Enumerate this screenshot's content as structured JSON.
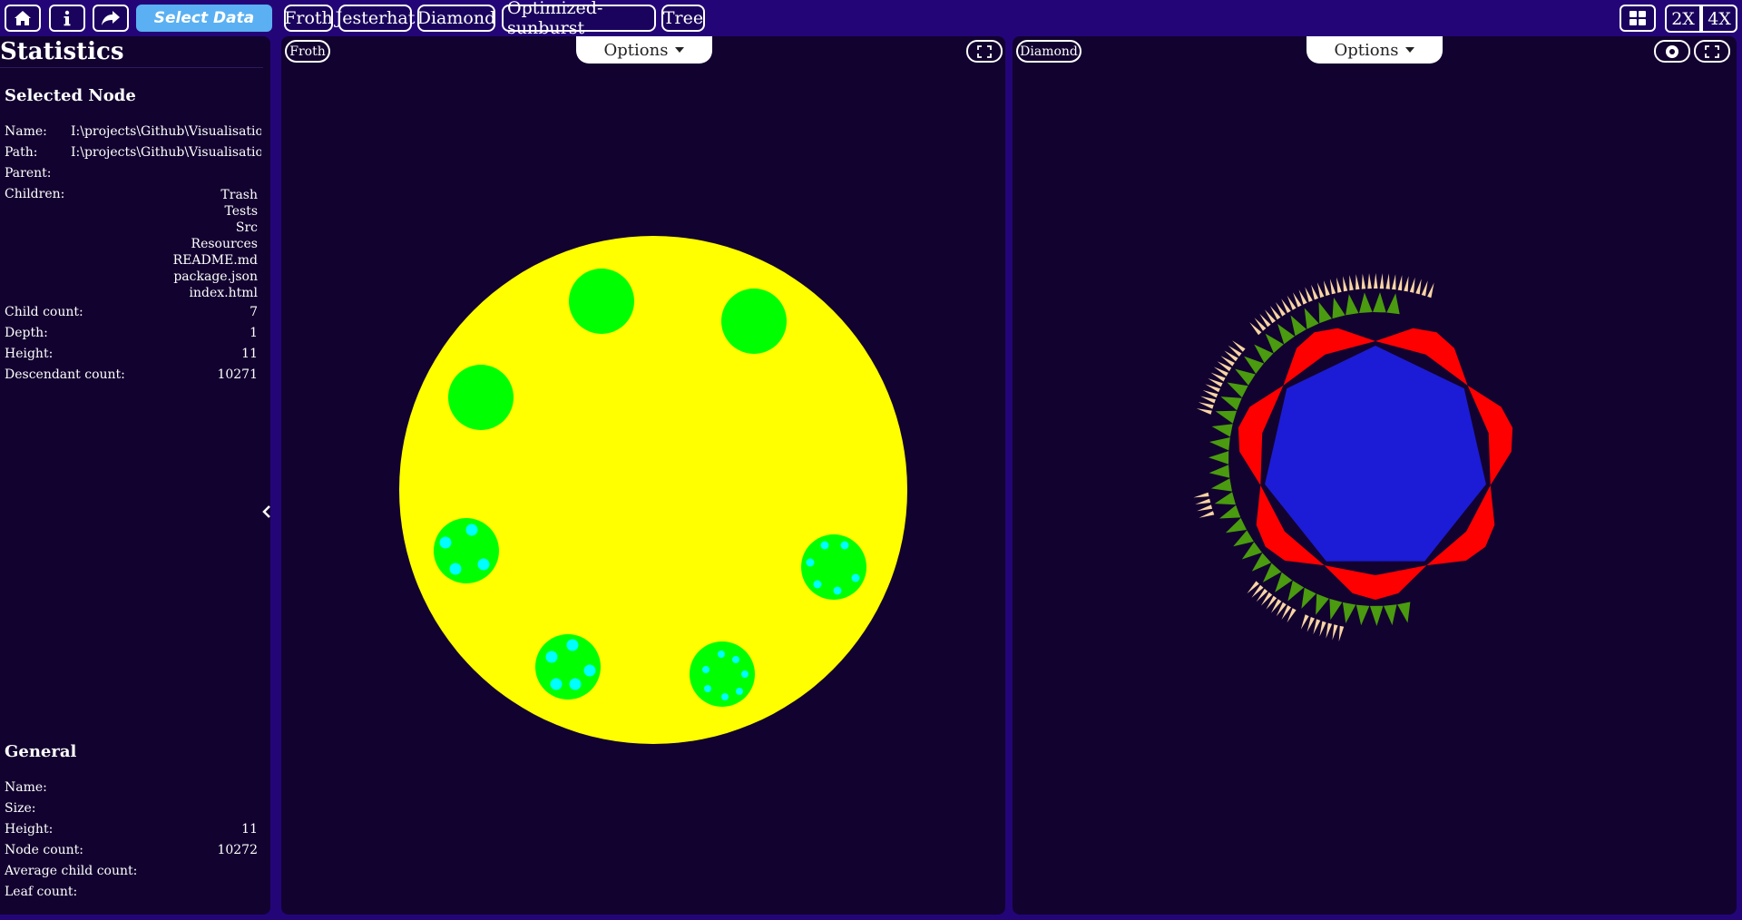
{
  "toolbar": {
    "home_icon": "home-icon",
    "info_icon": "info-icon",
    "share_icon": "share-icon",
    "select_data_label": "Select Data",
    "visualizations": [
      "Froth",
      "Jesterhat",
      "Diamond",
      "Optimized-sunburst",
      "Tree"
    ],
    "layout_icon": "grid-layout-icon",
    "zoom_2x": "2X",
    "zoom_4x": "4X"
  },
  "stats": {
    "title": "Statistics",
    "selected_node": {
      "heading": "Selected Node",
      "name_label": "Name:",
      "name_value": "I:\\projects\\Github\\Visualisation\\",
      "path_label": "Path:",
      "path_value": "I:\\projects\\Github\\Visualisation\\",
      "parent_label": "Parent:",
      "parent_value": "",
      "children_label": "Children:",
      "children": [
        "Trash",
        "Tests",
        "Src",
        "Resources",
        "README.md",
        "package.json",
        "index.html"
      ],
      "child_count_label": "Child count:",
      "child_count": "7",
      "depth_label": "Depth:",
      "depth": "1",
      "height_label": "Height:",
      "height": "11",
      "descendant_label": "Descendant count:",
      "descendant_count": "10271"
    },
    "general": {
      "heading": "General",
      "name_label": "Name:",
      "name_value": "",
      "size_label": "Size:",
      "size_value": "",
      "height_label": "Height:",
      "height": "11",
      "node_count_label": "Node count:",
      "node_count": "10272",
      "avg_child_label": "Average child count:",
      "avg_child_value": "",
      "leaf_label": "Leaf count:",
      "leaf_value": ""
    }
  },
  "panels": {
    "left": {
      "tag": "Froth",
      "options_label": "Options",
      "fullscreen_icon": "fullscreen-icon"
    },
    "right": {
      "tag": "Diamond",
      "options_label": "Options",
      "eye_icon": "eye-icon",
      "fullscreen_icon": "fullscreen-icon"
    }
  },
  "colors": {
    "background": "#230578",
    "panel": "#12022f",
    "froth_root": "#ffff00",
    "froth_child": "#00ff00",
    "froth_leaf": "#00ffff",
    "diamond_core": "#1c1cd6",
    "diamond_ring1": "#ff0000",
    "diamond_ring2": "#4a9b0f",
    "diamond_ring3": "#f8d4a4",
    "select_data": "#5ab0f2"
  }
}
